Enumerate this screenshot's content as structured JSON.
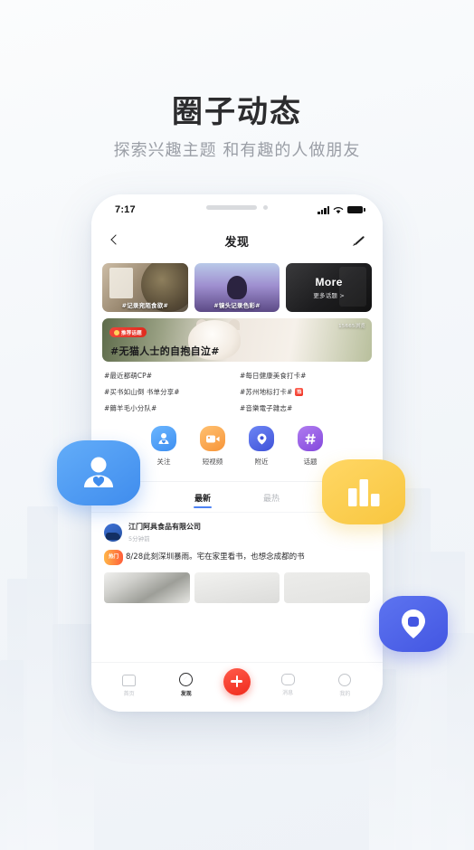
{
  "headline": {
    "title": "圈子动态",
    "subtitle": "探索兴趣主题 和有趣的人做朋友"
  },
  "phone": {
    "status_bar": {
      "time": "7:17",
      "signal_icon": "signal-bars-icon",
      "wifi_icon": "wifi-icon",
      "battery_icon": "battery-icon"
    },
    "nav": {
      "back_icon": "chevron-left-icon",
      "title": "发现",
      "edit_icon": "pencil-icon"
    },
    "topic_cards": [
      {
        "caption": "#记录宛陌食欲#",
        "name": "food"
      },
      {
        "caption": "#镜头记录色彩#",
        "name": "color"
      }
    ],
    "more_card": {
      "title_en": "More",
      "title_cn": "更多话题 >"
    },
    "banner": {
      "badge": "推荐话题",
      "views": "15665浏览",
      "title": "#无猫人士的自抱自泣#"
    },
    "hashtags": [
      {
        "label": "#最近都萌CP#",
        "hot": false
      },
      {
        "label": "#每日健康美食打卡#",
        "hot": false
      },
      {
        "label": "#买书如山倒 书单分享#",
        "hot": false
      },
      {
        "label": "#苏州地标打卡#",
        "hot": true,
        "hot_label": "热"
      },
      {
        "label": "#薅羊毛小分队#",
        "hot": false
      },
      {
        "label": "#音樂電子雜志#",
        "hot": false
      }
    ],
    "categories": [
      {
        "label": "关注",
        "icon": "person-heart-icon"
      },
      {
        "label": "短视频",
        "icon": "video-camera-icon"
      },
      {
        "label": "附近",
        "icon": "location-pin-icon"
      },
      {
        "label": "话题",
        "icon": "hashtag-icon"
      }
    ],
    "tabs": [
      {
        "label": "最新",
        "active": true
      },
      {
        "label": "最热",
        "active": false
      }
    ],
    "post": {
      "author": "江门阿具食品有限公司",
      "time": "5分钟前",
      "tag": "热门",
      "text": "8/28此刻深圳暴雨。宅在家里看书，也想念成都的书"
    },
    "bottom_nav": [
      {
        "label": "首页",
        "icon": "home-icon",
        "active": false
      },
      {
        "label": "发现",
        "icon": "compass-icon",
        "active": true
      },
      {
        "label": "发布",
        "icon": "plus-icon",
        "active": false
      },
      {
        "label": "消息",
        "icon": "message-icon",
        "active": false
      },
      {
        "label": "我的",
        "icon": "profile-icon",
        "active": false
      }
    ]
  },
  "floating_badges": [
    {
      "name": "follow-badge",
      "icon": "person-heart-icon",
      "color": "#3f8ced"
    },
    {
      "name": "stats-badge",
      "icon": "bar-chart-icon",
      "color": "#f8c63f"
    },
    {
      "name": "chat-badge",
      "icon": "chat-bubble-icon",
      "color": "#4356e2"
    }
  ]
}
